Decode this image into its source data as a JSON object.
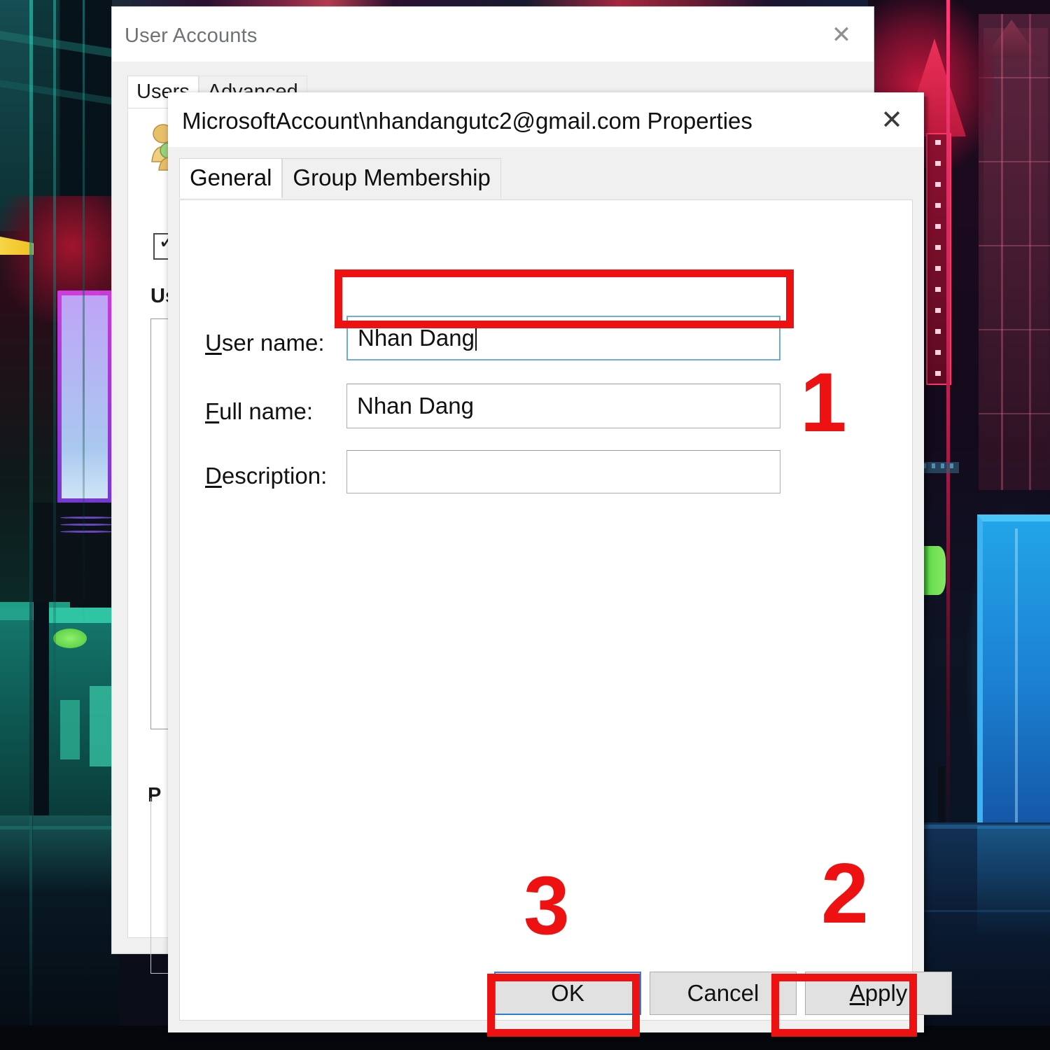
{
  "background_window": {
    "title": "User Accounts",
    "close_label": "✕",
    "tabs": [
      {
        "label": "Users",
        "active": true
      },
      {
        "label": "Advanced",
        "active": false
      }
    ],
    "checkbox_glyph": "✓",
    "partial_labels": {
      "users_must_label": "Us",
      "list_header": "U",
      "password_group": "P"
    }
  },
  "dialog": {
    "title": "MicrosoftAccount\\nhandangutc2@gmail.com Properties",
    "close_label": "✕",
    "tabs": [
      {
        "label": "General",
        "active": true
      },
      {
        "label": "Group Membership",
        "active": false
      }
    ],
    "fields": [
      {
        "label_pre": "U",
        "label_key": "U",
        "label_rest": "ser name:",
        "value": "Nhan Dang",
        "focused": true
      },
      {
        "label_pre": "F",
        "label_key": "F",
        "label_rest": "ull name:",
        "value": "Nhan Dang",
        "focused": false
      },
      {
        "label_pre": "D",
        "label_key": "D",
        "label_rest": "escription:",
        "value": "",
        "focused": false
      }
    ],
    "buttons": [
      {
        "label": "OK",
        "default": true,
        "mnemonic": ""
      },
      {
        "label": "Cancel",
        "default": false,
        "mnemonic": ""
      },
      {
        "label_pre": "A",
        "label_rest": "pply",
        "label": "Apply",
        "default": false,
        "mnemonic": "A"
      }
    ]
  },
  "annotations": {
    "step1": "1",
    "step2": "2",
    "step3": "3",
    "highlight_color": "#ee1111"
  }
}
